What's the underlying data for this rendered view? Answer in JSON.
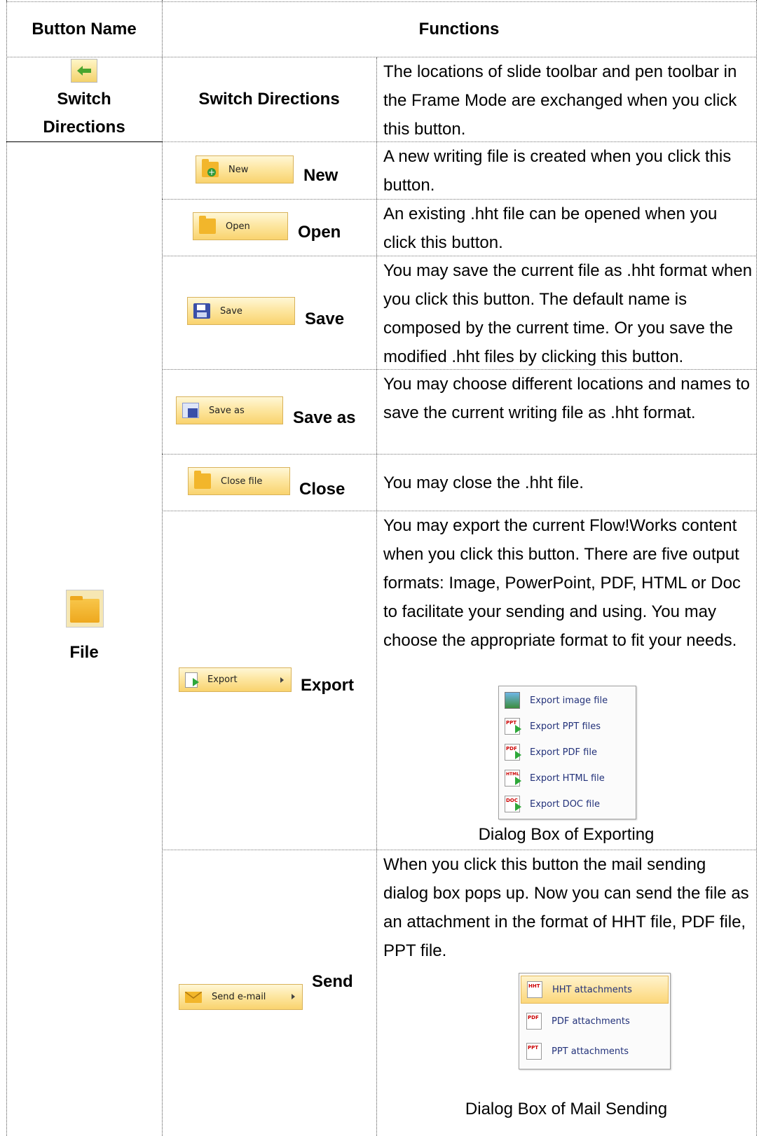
{
  "header": {
    "col1": "Button Name",
    "col2": "Functions"
  },
  "switch_row": {
    "name_line1": "Switch",
    "name_line2": "Directions",
    "mid_label": "Switch Directions",
    "desc": "The locations of slide toolbar and pen toolbar in the Frame Mode are exchanged when you click this button."
  },
  "file_group": {
    "name": "File",
    "rows": [
      {
        "button": "New",
        "label": "New",
        "desc": "A new writing file is created when you click this button."
      },
      {
        "button": "Open",
        "label": "Open",
        "desc": "An existing .hht file can be opened when you click this button."
      },
      {
        "button": "Save",
        "label": "Save",
        "desc": "You may save the current file as .hht format when you click this button. The default name is composed by the current time. Or you save the modified .hht files by clicking this button."
      },
      {
        "button": "Save as",
        "label": "Save as",
        "desc": "You may choose different locations and names to save the current writing file as .hht format."
      },
      {
        "button": "Close file",
        "label": "Close",
        "desc": "You may close the .hht file."
      },
      {
        "button": "Export",
        "label": "Export",
        "desc": "You may export the current Flow!Works content when you click this button. There are five output formats: Image, PowerPoint, PDF, HTML or Doc to facilitate your sending and using. You may choose the appropriate format to fit your needs."
      },
      {
        "button": "Send e-mail",
        "label": "Send",
        "desc": "When you click this button the mail sending dialog box pops up. Now you can send the file as an attachment in the format of HHT file, PDF file, PPT file."
      }
    ]
  },
  "export_menu": {
    "items": [
      {
        "label": "Export image file",
        "tag": ""
      },
      {
        "label": "Export PPT files",
        "tag": "PPT"
      },
      {
        "label": "Export PDF file",
        "tag": "PDF"
      },
      {
        "label": "Export HTML file",
        "tag": "HTML"
      },
      {
        "label": "Export DOC file",
        "tag": "DOC"
      }
    ],
    "caption": "Dialog Box of Exporting"
  },
  "mail_menu": {
    "items": [
      {
        "label": "HHT attachments",
        "tag": "HHT"
      },
      {
        "label": "PDF attachments",
        "tag": "PDF"
      },
      {
        "label": "PPT attachments",
        "tag": "PPT"
      }
    ],
    "caption": "Dialog Box of Mail Sending"
  },
  "icons": {
    "switch": "green-left-arrow-icon",
    "file": "folder-icon",
    "new": "new-file-icon",
    "open": "open-folder-icon",
    "save": "floppy-disk-icon",
    "saveas": "save-as-icon",
    "close": "close-file-icon",
    "export": "export-doc-icon",
    "send": "envelope-icon"
  },
  "colors": {
    "button_gradient_top": "#fff7d6",
    "button_gradient_bottom": "#f9d36e",
    "menu_text": "#23327a",
    "folder": "#f2b62b"
  }
}
